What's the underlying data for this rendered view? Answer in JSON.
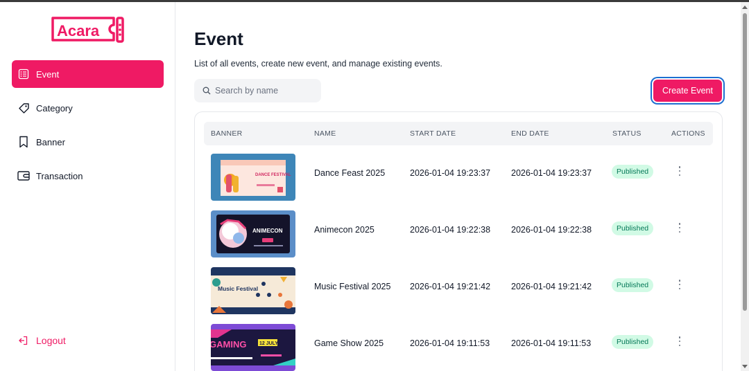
{
  "app": {
    "logo_text": "Acara",
    "brand_color": "#ef1a64"
  },
  "sidebar": {
    "items": [
      {
        "label": "Event",
        "icon": "list-icon",
        "active": true
      },
      {
        "label": "Category",
        "icon": "tag-icon",
        "active": false
      },
      {
        "label": "Banner",
        "icon": "bookmark-icon",
        "active": false
      },
      {
        "label": "Transaction",
        "icon": "wallet-icon",
        "active": false
      }
    ],
    "logout_label": "Logout"
  },
  "page": {
    "title": "Event",
    "subtitle": "List of all events, create new event, and manage existing events.",
    "search_placeholder": "Search by name",
    "create_button": "Create Event"
  },
  "table": {
    "headers": [
      "BANNER",
      "NAME",
      "START DATE",
      "END DATE",
      "STATUS",
      "ACTIONS"
    ],
    "rows": [
      {
        "name": "Dance Feast 2025",
        "start": "2026-01-04 19:23:37",
        "end": "2026-01-04 19:23:37",
        "status": "Published",
        "banner_text": "DANCE FESTIVAL"
      },
      {
        "name": "Animecon 2025",
        "start": "2026-01-04 19:22:38",
        "end": "2026-01-04 19:22:38",
        "status": "Published",
        "banner_text": "ANIMECON"
      },
      {
        "name": "Music Festival 2025",
        "start": "2026-01-04 19:21:42",
        "end": "2026-01-04 19:21:42",
        "status": "Published",
        "banner_text": "Music Festival"
      },
      {
        "name": "Game Show 2025",
        "start": "2026-01-04 19:11:53",
        "end": "2026-01-04 19:11:53",
        "status": "Published",
        "banner_text": "GAMING",
        "banner_sub": "12 JULY"
      }
    ]
  }
}
